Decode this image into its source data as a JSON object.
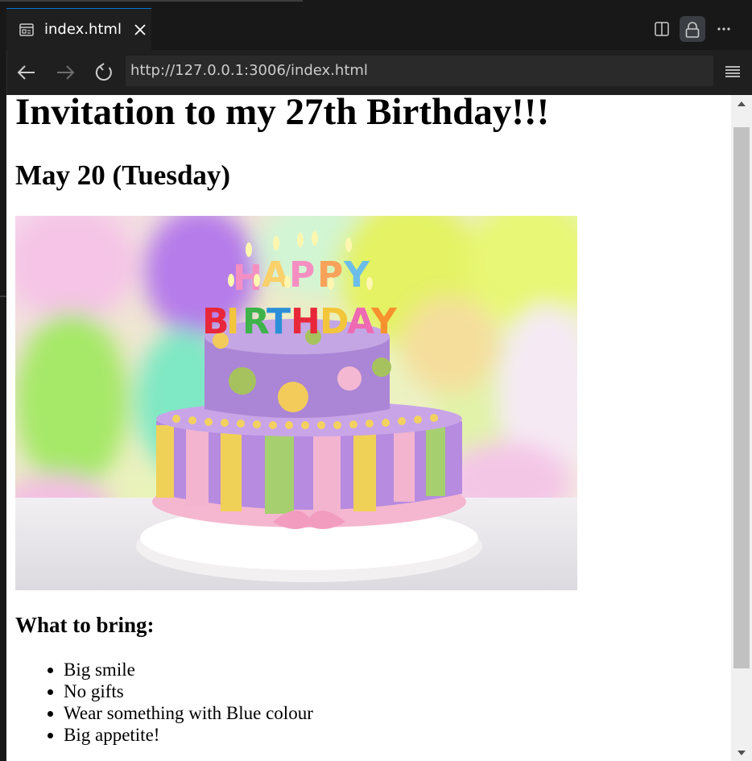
{
  "tab": {
    "title": "index.html",
    "icon": "preview-icon"
  },
  "toolbar": {
    "split_icon": "split-editor-icon",
    "lock_icon": "lock-icon",
    "more_icon": "more-actions-icon"
  },
  "nav": {
    "back_icon": "arrow-left-icon",
    "forward_icon": "arrow-right-icon",
    "reload_icon": "reload-icon",
    "url": "http://127.0.0.1:3006/index.html",
    "menu_icon": "hamburger-menu-icon"
  },
  "page": {
    "heading": "Invitation to my 27th Birthday!!!",
    "date": "May 20 (Tuesday)",
    "image_caption_letters": [
      "H",
      "A",
      "P",
      "P",
      "Y",
      "B",
      "I",
      "R",
      "T",
      "H",
      "D",
      "A",
      "Y"
    ],
    "bring_heading": "What to bring:",
    "bring_items": [
      "Big smile",
      "No gifts",
      "Wear something with Blue colour",
      "Big appetite!"
    ]
  },
  "colors": {
    "accent": "#0078d4",
    "tab_bg": "#1f1f1f",
    "bar_bg": "#181818"
  }
}
